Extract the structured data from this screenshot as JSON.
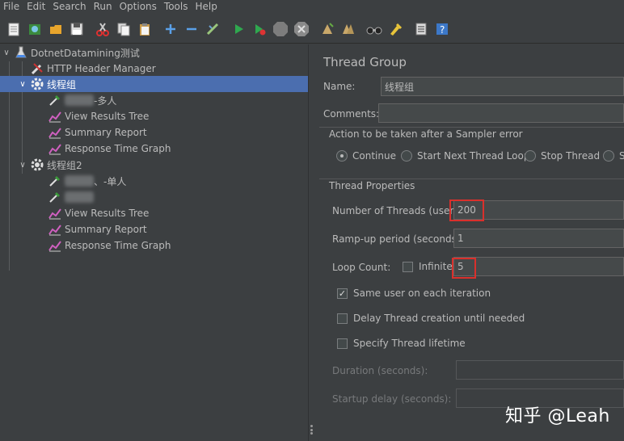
{
  "menu": [
    {
      "label": "File"
    },
    {
      "label": "Edit"
    },
    {
      "label": "Search"
    },
    {
      "label": "Run"
    },
    {
      "label": "Options"
    },
    {
      "label": "Tools"
    },
    {
      "label": "Help"
    }
  ],
  "toolbar": [
    {
      "icon": "new-file-icon"
    },
    {
      "icon": "templates-icon"
    },
    {
      "icon": "open-icon"
    },
    {
      "icon": "save-icon"
    },
    {
      "icon": "cut-icon"
    },
    {
      "icon": "copy-icon"
    },
    {
      "icon": "paste-icon"
    },
    {
      "icon": "expand-icon"
    },
    {
      "icon": "collapse-icon"
    },
    {
      "icon": "toggle-icon"
    },
    {
      "icon": "start-icon"
    },
    {
      "icon": "start-no-pauses-icon"
    },
    {
      "icon": "stop-icon"
    },
    {
      "icon": "shutdown-icon"
    },
    {
      "icon": "clear-icon"
    },
    {
      "icon": "clear-all-icon"
    },
    {
      "icon": "search-icon"
    },
    {
      "icon": "reset-search-icon"
    },
    {
      "icon": "function-helper-icon"
    },
    {
      "icon": "help-icon"
    }
  ],
  "tree": {
    "root": "DotnetDatamining测试",
    "header_manager": "HTTP Header Manager",
    "group1": {
      "label": "线程组",
      "sampler": "-多人",
      "listeners": [
        "View Results Tree",
        "Summary Report",
        "Response Time Graph"
      ]
    },
    "group2": {
      "label": "线程组2",
      "sampler1": "、-单人",
      "listeners": [
        "View Results Tree",
        "Summary Report",
        "Response Time Graph"
      ]
    }
  },
  "panel": {
    "title": "Thread Group",
    "name_label": "Name:",
    "name_value": "线程组",
    "comments_label": "Comments:",
    "comments_value": "",
    "error_section": "Action to be taken after a Sampler error",
    "error_options": [
      "Continue",
      "Start Next Thread Loop",
      "Stop Thread",
      "S"
    ],
    "error_selected": "Continue",
    "props_section": "Thread Properties",
    "threads_label": "Number of Threads (users):",
    "threads_value": "200",
    "rampup_label": "Ramp-up period (seconds):",
    "rampup_value": "1",
    "loop_label": "Loop Count:",
    "infinite_label": "Infinite",
    "infinite_checked": false,
    "loop_value": "5",
    "same_user_label": "Same user on each iteration",
    "same_user_checked": true,
    "delay_label": "Delay Thread creation until needed",
    "delay_checked": false,
    "lifetime_label": "Specify Thread lifetime",
    "lifetime_checked": false,
    "duration_label": "Duration (seconds):",
    "startup_label": "Startup delay (seconds):"
  },
  "watermark": "知乎 @Leah"
}
